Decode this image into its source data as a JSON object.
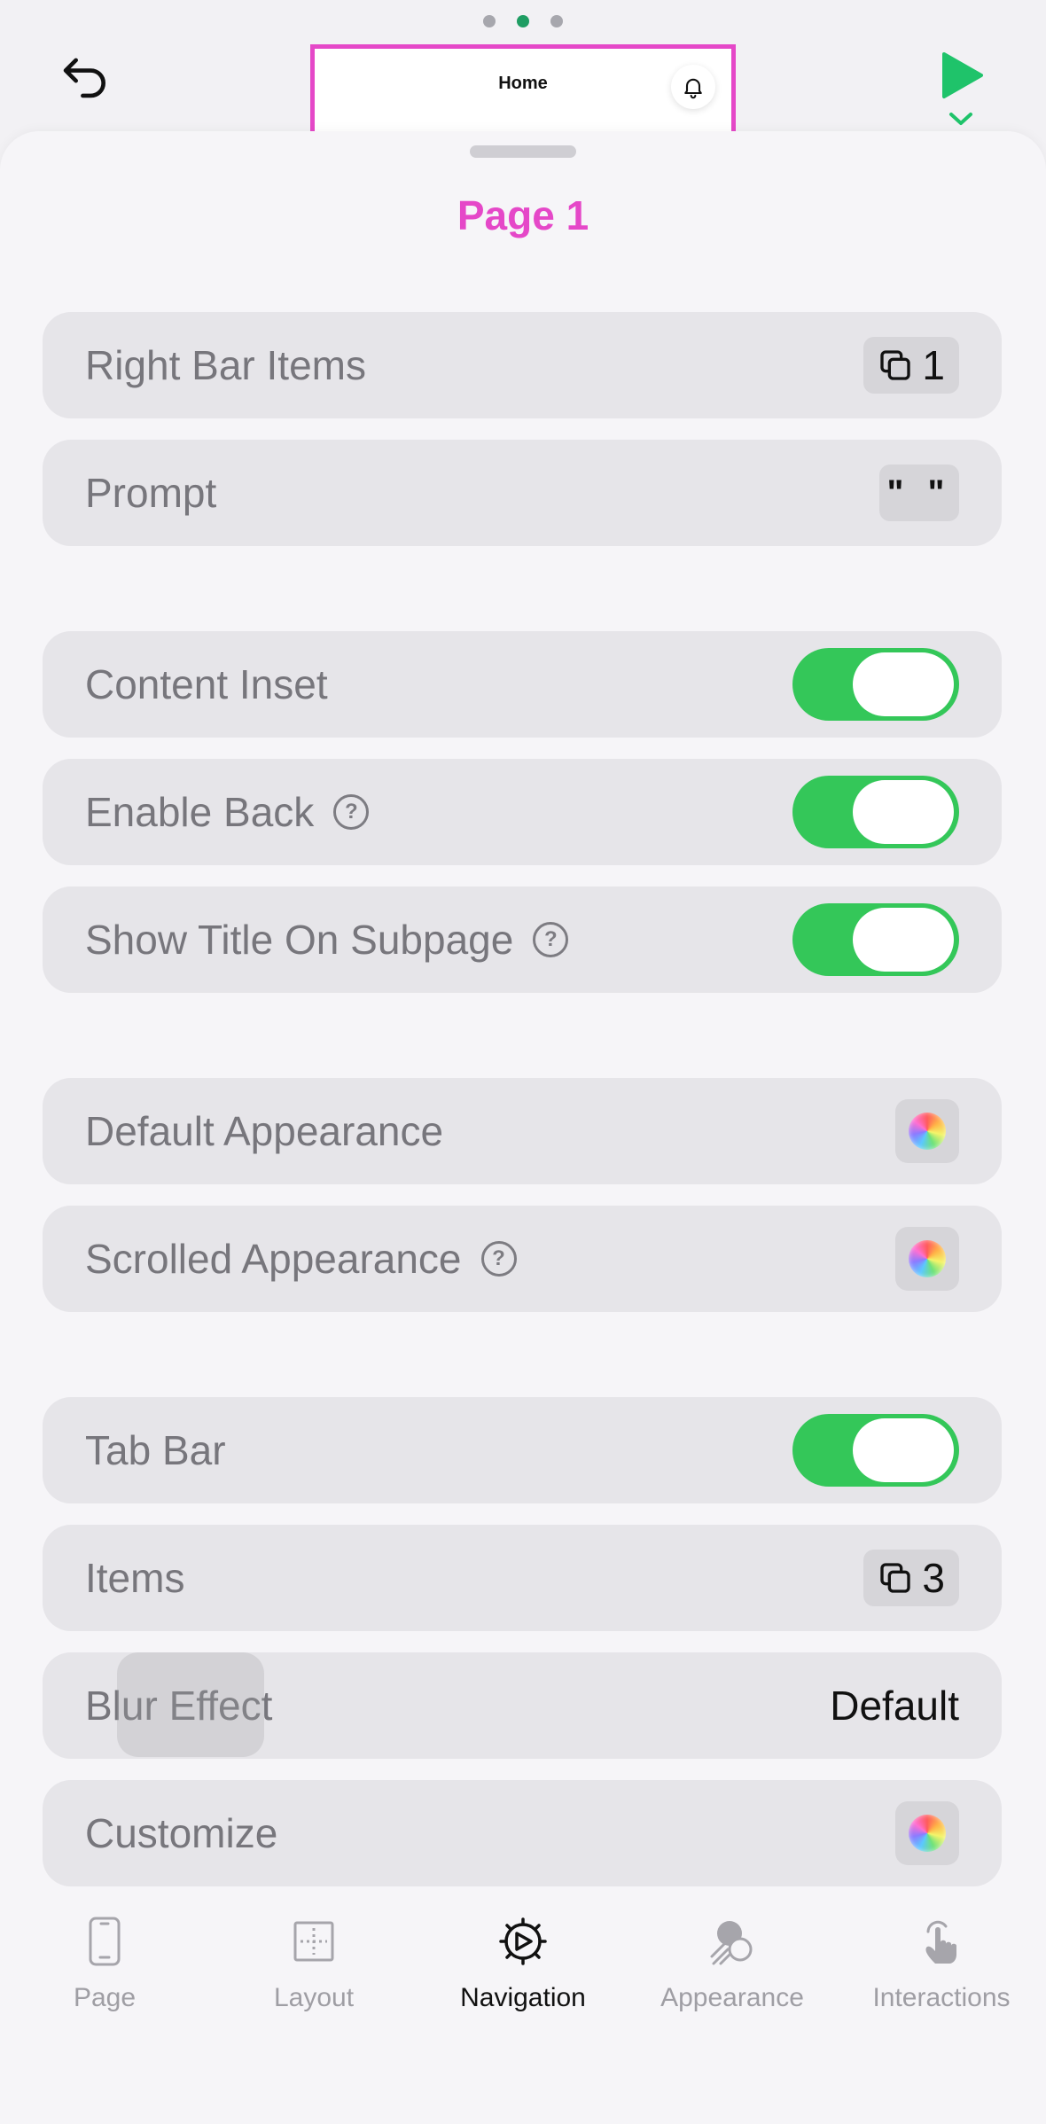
{
  "preview": {
    "title": "Home"
  },
  "sheet": {
    "title": "Page 1"
  },
  "rows": {
    "right_bar_items": {
      "label": "Right Bar Items",
      "count": "1"
    },
    "prompt": {
      "label": "Prompt",
      "value": "\" \""
    },
    "content_inset": {
      "label": "Content Inset",
      "on": true
    },
    "enable_back": {
      "label": "Enable Back",
      "on": true
    },
    "show_title_on_subpage": {
      "label": "Show Title On Subpage",
      "on": true
    },
    "default_appearance": {
      "label": "Default Appearance"
    },
    "scrolled_appearance": {
      "label": "Scrolled Appearance"
    },
    "tab_bar": {
      "label": "Tab Bar",
      "on": true
    },
    "items": {
      "label": "Items",
      "count": "3"
    },
    "blur_effect": {
      "label": "Blur Effect",
      "value": "Default"
    },
    "customize": {
      "label": "Customize"
    }
  },
  "help_glyph": "?",
  "tabs": [
    {
      "label": "Page",
      "icon": "phone-icon",
      "active": false
    },
    {
      "label": "Layout",
      "icon": "layout-grid-icon",
      "active": false
    },
    {
      "label": "Navigation",
      "icon": "compass-gear-icon",
      "active": true
    },
    {
      "label": "Appearance",
      "icon": "appearance-icon",
      "active": false
    },
    {
      "label": "Interactions",
      "icon": "tap-hand-icon",
      "active": false
    }
  ],
  "colors": {
    "accent_pink": "#e548c8",
    "toggle_on": "#34c759",
    "play_green": "#1fc36a",
    "dot_active": "#1f9d63"
  }
}
